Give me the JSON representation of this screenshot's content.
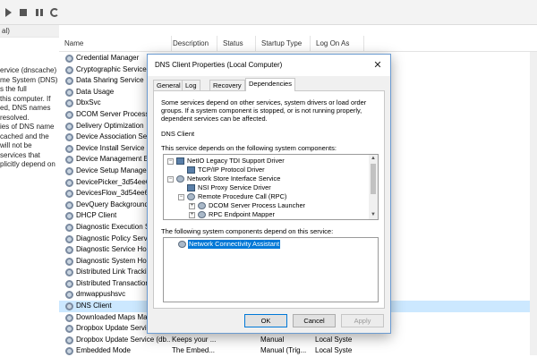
{
  "toolbar": {
    "buttons": [
      "play-icon",
      "stop-icon",
      "pause-icon",
      "restart-icon"
    ]
  },
  "left_pane": {
    "header": "al)",
    "description": "ervice (dnscache)\nme System (DNS)\ns the full\nthis computer. If\ned, DNS names\nresolved.\nies of DNS name\ncached and the\nwill not be\nservices that\nplicitly depend on"
  },
  "columns": {
    "name": "Name",
    "description": "Description",
    "status": "Status",
    "startup": "Startup Type",
    "logon": "Log On As"
  },
  "services": [
    {
      "name": "Credential Manager",
      "desc": "",
      "status": "",
      "start": "",
      "logon": ""
    },
    {
      "name": "Cryptographic Services",
      "desc": "",
      "status": "",
      "start": "",
      "logon": ""
    },
    {
      "name": "Data Sharing Service",
      "desc": "",
      "status": "",
      "start": "",
      "logon": ""
    },
    {
      "name": "Data Usage",
      "desc": "",
      "status": "",
      "start": "",
      "logon": ""
    },
    {
      "name": "DbxSvc",
      "desc": "",
      "status": "",
      "start": "",
      "logon": ""
    },
    {
      "name": "DCOM Server Process L",
      "desc": "",
      "status": "",
      "start": "",
      "logon": ""
    },
    {
      "name": "Delivery Optimization",
      "desc": "",
      "status": "",
      "start": "",
      "logon": ""
    },
    {
      "name": "Device Association Se",
      "desc": "",
      "status": "",
      "start": "",
      "logon": ""
    },
    {
      "name": "Device Install Service",
      "desc": "",
      "status": "",
      "start": "",
      "logon": ""
    },
    {
      "name": "Device Management E",
      "desc": "",
      "status": "",
      "start": "",
      "logon": ""
    },
    {
      "name": "Device Setup Manager",
      "desc": "",
      "status": "",
      "start": "",
      "logon": ""
    },
    {
      "name": "DevicePicker_3d54ee6",
      "desc": "",
      "status": "",
      "start": "",
      "logon": ""
    },
    {
      "name": "DevicesFlow_3d54ee6",
      "desc": "",
      "status": "",
      "start": "",
      "logon": ""
    },
    {
      "name": "DevQuery Background",
      "desc": "",
      "status": "",
      "start": "",
      "logon": ""
    },
    {
      "name": "DHCP Client",
      "desc": "",
      "status": "",
      "start": "",
      "logon": ""
    },
    {
      "name": "Diagnostic Execution S",
      "desc": "",
      "status": "",
      "start": "",
      "logon": ""
    },
    {
      "name": "Diagnostic Policy Servi",
      "desc": "",
      "status": "",
      "start": "",
      "logon": ""
    },
    {
      "name": "Diagnostic Service Hos",
      "desc": "",
      "status": "",
      "start": "",
      "logon": ""
    },
    {
      "name": "Diagnostic System Host",
      "desc": "",
      "status": "",
      "start": "",
      "logon": ""
    },
    {
      "name": "Distributed Link Trackin",
      "desc": "",
      "status": "",
      "start": "",
      "logon": ""
    },
    {
      "name": "Distributed Transaction",
      "desc": "",
      "status": "",
      "start": "",
      "logon": ""
    },
    {
      "name": "dmwappushsvc",
      "desc": "",
      "status": "",
      "start": "",
      "logon": ""
    },
    {
      "name": "DNS Client",
      "desc": "",
      "status": "",
      "start": "",
      "logon": "",
      "selected": true
    },
    {
      "name": "Downloaded Maps Mana",
      "desc": "",
      "status": "",
      "start": "",
      "logon": ""
    },
    {
      "name": "Dropbox Update Service",
      "desc": "Keeps your ...",
      "status": "",
      "start": "Manual",
      "logon": "Local Syste"
    },
    {
      "name": "Dropbox Update Service (db...",
      "desc": "Keeps your ...",
      "status": "",
      "start": "Manual",
      "logon": "Local Syste"
    },
    {
      "name": "Embedded Mode",
      "desc": "The Embed...",
      "status": "",
      "start": "Manual (Trig...",
      "logon": "Local Syste"
    }
  ],
  "dialog": {
    "title": "DNS Client Properties (Local Computer)",
    "close_icon": "close-icon",
    "tabs": [
      "General",
      "Log On",
      "Recovery",
      "Dependencies"
    ],
    "active_tab": 3,
    "intro": "Some services depend on other services, system drivers or load order groups. If a system component is stopped, or is not running properly, dependent services can be affected.",
    "service_name": "DNS Client",
    "depends_label": "This service depends on the following system components:",
    "dependencies": [
      {
        "label": "NetIO Legacy TDI Support Driver",
        "level": 0,
        "expander": "-",
        "icon": "driver-icon"
      },
      {
        "label": "TCP/IP Protocol Driver",
        "level": 1,
        "expander": "",
        "icon": "driver-icon"
      },
      {
        "label": "Network Store Interface Service",
        "level": 0,
        "expander": "-",
        "icon": "gear-icon"
      },
      {
        "label": "NSI Proxy Service Driver",
        "level": 1,
        "expander": "",
        "icon": "driver-icon"
      },
      {
        "label": "Remote Procedure Call (RPC)",
        "level": 1,
        "expander": "-",
        "icon": "gear-icon"
      },
      {
        "label": "DCOM Server Process Launcher",
        "level": 2,
        "expander": "+",
        "icon": "gear-icon"
      },
      {
        "label": "RPC Endpoint Mapper",
        "level": 2,
        "expander": "+",
        "icon": "gear-icon"
      }
    ],
    "dependents_label": "The following system components depend on this service:",
    "dependents": [
      {
        "label": "Network Connectivity Assistant",
        "icon": "gear-icon",
        "selected": true
      }
    ],
    "buttons": {
      "ok": "OK",
      "cancel": "Cancel",
      "apply": "Apply"
    }
  }
}
